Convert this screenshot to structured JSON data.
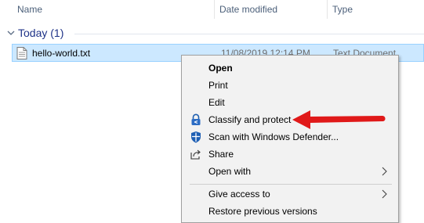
{
  "columns": {
    "name": "Name",
    "date_modified": "Date modified",
    "type": "Type"
  },
  "group": {
    "label": "Today (1)"
  },
  "file": {
    "name": "hello-world.txt",
    "date": "11/08/2019 12:14 PM",
    "type": "Text Document"
  },
  "context_menu": {
    "items": [
      {
        "label": "Open",
        "icon": null,
        "submenu": false
      },
      {
        "label": "Print",
        "icon": null,
        "submenu": false
      },
      {
        "label": "Edit",
        "icon": null,
        "submenu": false
      },
      {
        "label": "Classify and protect",
        "icon": "classify-lock-icon",
        "submenu": false
      },
      {
        "label": "Scan with Windows Defender...",
        "icon": "windows-defender-icon",
        "submenu": false
      },
      {
        "label": "Share",
        "icon": "share-icon",
        "submenu": false
      },
      {
        "label": "Open with",
        "icon": null,
        "submenu": true
      },
      {
        "label": "Give access to",
        "icon": null,
        "submenu": true
      },
      {
        "label": "Restore previous versions",
        "icon": null,
        "submenu": false
      }
    ]
  },
  "colors": {
    "selection": "#cce8ff",
    "selection_border": "#99d1ff",
    "menu_bg": "#f2f2f2",
    "annotation_arrow": "#e01919",
    "group_label": "#1e3287"
  }
}
